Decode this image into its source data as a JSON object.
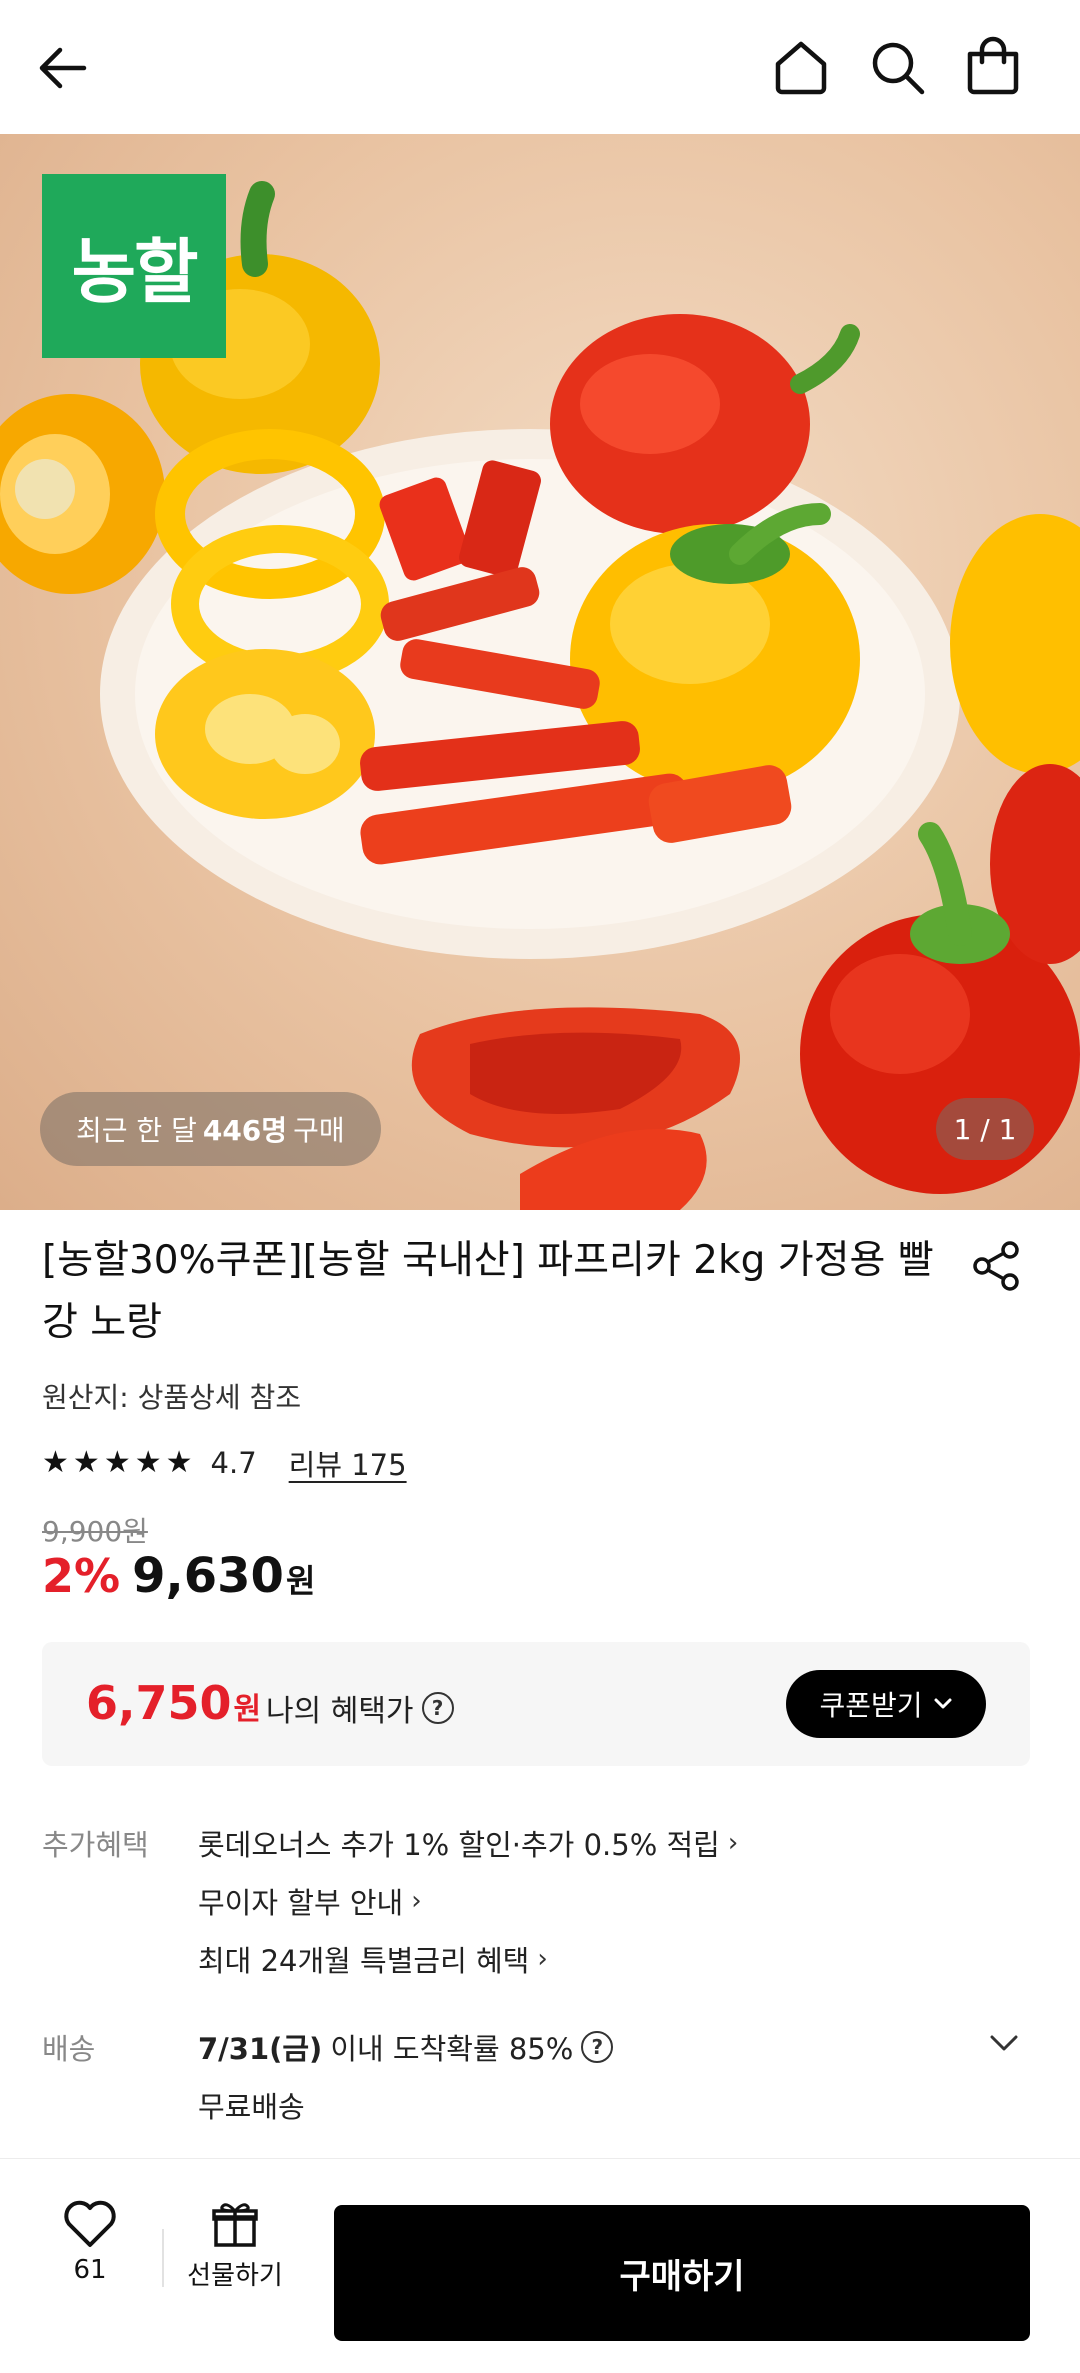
{
  "header": {
    "back_icon": "arrow-left-icon",
    "home_icon": "home-icon",
    "search_icon": "search-icon",
    "cart_icon": "shopping-bag-icon"
  },
  "hero": {
    "brand_logo_text": "농할",
    "buyers_prefix": "최근 한 달",
    "buyers_count": "446명",
    "buyers_suffix": "구매",
    "page_indicator": "1 / 1"
  },
  "product": {
    "title": "[농할30%쿠폰][농할 국내산] 파프리카 2kg 가정용 빨강 노랑",
    "origin": "원산지: 상품상세 참조",
    "rating": "4.7",
    "stars": 4.7,
    "review_link": "리뷰 175",
    "original_price": "9,900원",
    "discount_percent": "2%",
    "price": "9,630",
    "price_unit": "원"
  },
  "benefit": {
    "price": "6,750",
    "price_unit": "원",
    "label": "나의 혜택가",
    "coupon_button": "쿠폰받기"
  },
  "extra_benefits": {
    "label": "추가혜택",
    "items": [
      "롯데오너스 추가 1% 할인·추가 0.5% 적립",
      "무이자 할부 안내",
      "최대 24개월 특별금리 혜택"
    ]
  },
  "shipping": {
    "label": "배송",
    "date": "7/31(금)",
    "arrival_text": "이내 도착확률 85%",
    "fee": "무료배송"
  },
  "bottom": {
    "like_count": "61",
    "gift_label": "선물하기",
    "buy_button": "구매하기"
  },
  "colors": {
    "accent_red": "#e4202a",
    "brand_green": "#1fa95a",
    "button_black": "#000000"
  }
}
